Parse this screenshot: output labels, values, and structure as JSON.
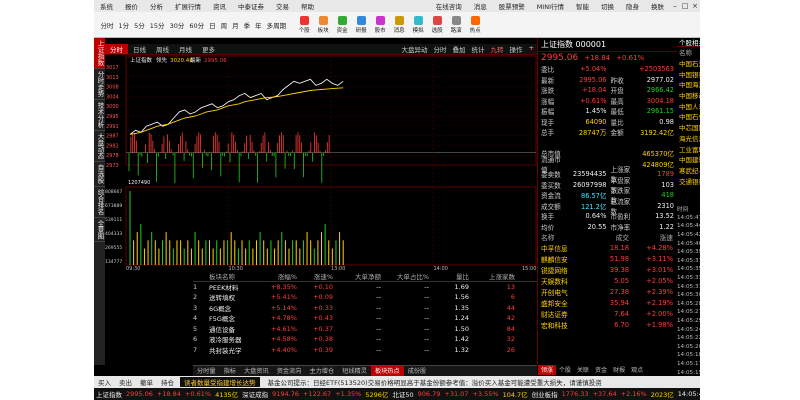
{
  "menubar": {
    "items": [
      "系统",
      "报价",
      "分析",
      "扩展行情",
      "资讯",
      "中泰证券",
      "交易",
      "帮助"
    ],
    "right_items": [
      "在线咨询",
      "消息",
      "股票预警",
      "MINI行情",
      "智能",
      "切换",
      "隐身",
      "换肤"
    ]
  },
  "toolbar": {
    "periods": [
      "分时",
      "1分",
      "5分",
      "15分",
      "30分",
      "60分",
      "日",
      "周",
      "月",
      "季",
      "年",
      "多周期"
    ],
    "buttons": [
      {
        "label": "个股",
        "color": "#e33"
      },
      {
        "label": "板块",
        "color": "#e83"
      },
      {
        "label": "资金",
        "color": "#3a3"
      },
      {
        "label": "研报",
        "color": "#38d"
      },
      {
        "label": "股市",
        "color": "#c3c"
      },
      {
        "label": "消息",
        "color": "#c90"
      },
      {
        "label": "模拟",
        "color": "#3bc"
      },
      {
        "label": "选股",
        "color": "#d44"
      },
      {
        "label": "路演",
        "color": "#888"
      },
      {
        "label": "热点",
        "color": "#f60"
      }
    ]
  },
  "leftbar": [
    "上证指数",
    "分时走势",
    "技术分析",
    "大盘动态",
    "自选股",
    "综合排名",
    "全景图"
  ],
  "chart_tabs": {
    "tabs": [
      "分时",
      "日线",
      "周线",
      "月线",
      "更多"
    ],
    "right": [
      "大盘异动",
      "分时",
      "叠加",
      "统计",
      "九转",
      "操作",
      "+"
    ]
  },
  "chart_header": {
    "name": "上证指数",
    "label2": "领先",
    "v1": "3020.48",
    "label3": "最新",
    "v2": "2995.06"
  },
  "chart_data": {
    "type": "line",
    "y_ticks": [
      "3017",
      "3013",
      "3008",
      "3004",
      "3000",
      "2995",
      "2991",
      "2987",
      "2982",
      "2978",
      "2973"
    ],
    "vol_header": "1207490",
    "vol_ticks": [
      "808667",
      "673889",
      "539111",
      "404333",
      "269555",
      "134777"
    ],
    "x_labels": [
      "09:30",
      "10:30",
      "13:00",
      "14:00",
      "15:00"
    ],
    "ylim": [
      2971,
      3019
    ],
    "series": [
      {
        "values": [
          2986,
          2988,
          2987,
          2990,
          2991,
          2992,
          2990,
          2991,
          2994,
          2997,
          2998,
          2996,
          2997,
          2999,
          3000,
          3001,
          2999,
          3000,
          3002,
          3003,
          3005,
          3006,
          3004,
          3005,
          3006,
          3003,
          3004,
          3005,
          3008,
          3010,
          3012,
          3011,
          3012,
          3013,
          3010,
          3011,
          3013,
          3011,
          3010,
          3012
        ]
      },
      {
        "values": [
          2986,
          2986.5,
          2987,
          2988,
          2989,
          2990,
          2990.5,
          2991,
          2992,
          2993,
          2994,
          2994.5,
          2995,
          2996,
          2997,
          2997.5,
          2998,
          2999,
          3000,
          3000.5,
          3001,
          3002,
          3002.5,
          3003,
          3003.5,
          3004,
          3004.2,
          3004.5,
          3005,
          3005.5,
          3006,
          3006.5,
          3007,
          3007.5,
          3007.8,
          3008,
          3008.2,
          3008.4,
          3008.6,
          3008.8
        ]
      }
    ],
    "volumes": [
      9,
      3,
      4,
      5,
      2,
      3,
      4,
      3,
      2,
      3,
      4,
      3,
      2,
      3,
      3,
      2,
      3,
      2,
      4,
      3,
      2,
      3,
      3,
      2,
      3,
      2,
      3,
      3,
      4,
      3,
      2,
      3,
      2,
      3,
      2,
      3,
      4,
      3,
      2,
      3,
      2,
      3,
      4,
      3,
      2,
      3,
      3,
      2,
      3,
      4,
      3,
      2,
      3,
      4,
      5,
      3,
      2,
      3,
      4,
      3
    ]
  },
  "sector_table": {
    "headers": [
      "板块名称",
      "涨幅%",
      "涨速%",
      "大单净额",
      "大单占比%",
      "量比",
      "上涨家数"
    ],
    "rows": [
      {
        "no": "1",
        "name": "PEEK材料",
        "p1": "+8.35%",
        "p2": "+0.10",
        "big": "--",
        "ratio": "--",
        "vol": "1.69",
        "up": "13"
      },
      {
        "no": "2",
        "name": "送转填权",
        "p1": "+5.41%",
        "p2": "+0.09",
        "big": "--",
        "ratio": "--",
        "vol": "1.56",
        "up": "6"
      },
      {
        "no": "3",
        "name": "6G概念",
        "p1": "+5.14%",
        "p2": "+0.33",
        "big": "--",
        "ratio": "--",
        "vol": "1.35",
        "up": "44"
      },
      {
        "no": "4",
        "name": "F5G概念",
        "p1": "+4.78%",
        "p2": "+0.43",
        "big": "--",
        "ratio": "--",
        "vol": "1.24",
        "up": "42"
      },
      {
        "no": "5",
        "name": "通信设备",
        "p1": "+4.61%",
        "p2": "+0.37",
        "big": "--",
        "ratio": "--",
        "vol": "1.50",
        "up": "84"
      },
      {
        "no": "6",
        "name": "液冷服务器",
        "p1": "+4.58%",
        "p2": "+0.38",
        "big": "--",
        "ratio": "--",
        "vol": "1.42",
        "up": "32"
      },
      {
        "no": "7",
        "name": "共封装光学",
        "p1": "+4.40%",
        "p2": "+0.39",
        "big": "--",
        "ratio": "--",
        "vol": "1.32",
        "up": "26"
      }
    ]
  },
  "bottom_tabs": [
    "分时量",
    "指标",
    "大盘资讯",
    "资金流向",
    "主力增仓",
    "短线精灵",
    "板块热点",
    "成份股"
  ],
  "buttons_bar": {
    "items": [
      "买入",
      "卖出",
      "撤单",
      "持仓"
    ],
    "notice": "读者数量受指建增长达势",
    "notice2": "基金公司提示：日经ETF(513520)交易价格明显高于基金份额参考值：溢价买入基金可能遭受重大损失，请谨慎投资"
  },
  "status": {
    "items": [
      {
        "t": "上证指数",
        "c": "white-t"
      },
      {
        "t": "2995.06",
        "c": "red"
      },
      {
        "t": "+18.84",
        "c": "red"
      },
      {
        "t": "+0.61%",
        "c": "red"
      },
      {
        "t": "4135亿",
        "c": "yellow"
      },
      {
        "t": "深证成指",
        "c": "white-t"
      },
      {
        "t": "9194.76",
        "c": "red"
      },
      {
        "t": "+122.67",
        "c": "red"
      },
      {
        "t": "+1.35%",
        "c": "red"
      },
      {
        "t": "5296亿",
        "c": "yellow"
      },
      {
        "t": "北证50",
        "c": "white-t"
      },
      {
        "t": "906.79",
        "c": "red"
      },
      {
        "t": "+31.07",
        "c": "red"
      },
      {
        "t": "+3.55%",
        "c": "red"
      },
      {
        "t": "104.7亿",
        "c": "yellow"
      },
      {
        "t": "创业板指",
        "c": "white-t"
      },
      {
        "t": "1776.33",
        "c": "red"
      },
      {
        "t": "+37.64",
        "c": "red"
      },
      {
        "t": "+2.16%",
        "c": "red"
      },
      {
        "t": "2023亿",
        "c": "yellow"
      }
    ],
    "time": "14:05:47"
  },
  "quote": {
    "title": "上证指数 000001",
    "price": "2995.06",
    "change": "+18.84",
    "pct": "+0.61%",
    "rows": [
      {
        "k": "委比",
        "v": "+5.04%",
        "vc": "red",
        "k2": "",
        "v2": "+2503563",
        "v2c": "red"
      },
      {
        "k": "最新",
        "v": "2995.06",
        "vc": "red",
        "k2": "昨收",
        "v2": "2977.02",
        "v2c": "white-t"
      },
      {
        "k": "涨跌",
        "v": "+18.04",
        "vc": "red",
        "k2": "开盘",
        "v2": "2966.42",
        "v2c": "green"
      },
      {
        "k": "涨幅",
        "v": "+0.61%",
        "vc": "red",
        "k2": "最高",
        "v2": "3004.18",
        "v2c": "red"
      },
      {
        "k": "振幅",
        "v": "1.45%",
        "vc": "white-t",
        "k2": "最低",
        "v2": "2961.15",
        "v2c": "green"
      },
      {
        "k": "现手",
        "v": "64090",
        "vc": "yellow",
        "k2": "量比",
        "v2": "0.98",
        "v2c": "white-t"
      },
      {
        "k": "总手",
        "v": "28747万",
        "vc": "yellow",
        "k2": "金额",
        "v2": "3192.42亿",
        "v2c": "yellow"
      },
      {
        "k": "",
        "v": "",
        "vc": "white-t",
        "k2": "",
        "v2": "",
        "v2c": "white-t"
      },
      {
        "k": "总市值",
        "v": "",
        "vc": "white-t",
        "k2": "",
        "v2": "465370亿",
        "v2c": "yellow"
      },
      {
        "k": "流通市值",
        "v": "",
        "vc": "white-t",
        "k2": "",
        "v2": "424809亿",
        "v2c": "yellow"
      },
      {
        "k": "委卖数",
        "v": "23594435",
        "vc": "white-t",
        "k2": "上涨家数",
        "v2": "1789",
        "v2c": "red"
      },
      {
        "k": "委买数",
        "v": "26097998",
        "vc": "white-t",
        "k2": "平盘家数",
        "v2": "103",
        "v2c": "white-t"
      },
      {
        "k": "资金流",
        "v": "86.57亿",
        "vc": "cyan",
        "k2": "下跌家数",
        "v2": "418",
        "v2c": "green"
      },
      {
        "k": "成交额",
        "v": "121.2亿",
        "vc": "cyan",
        "k2": "总流家数",
        "v2": "2310",
        "v2c": "white-t"
      },
      {
        "k": "换手",
        "v": "0.64%",
        "vc": "white-t",
        "k2": "市盈利",
        "v2": "13.52",
        "v2c": "white-t"
      },
      {
        "k": "均价",
        "v": "20.55",
        "vc": "white-t",
        "k2": "市净率",
        "v2": "1.22",
        "v2c": "white-t"
      }
    ],
    "tick_header": [
      "名称",
      "成交",
      "涨速"
    ],
    "ticks": [
      {
        "n": "中孚信息",
        "p": "18.18",
        "c": "+4.28%"
      },
      {
        "n": "麒麟信安",
        "p": "51.98",
        "c": "+3.11%"
      },
      {
        "n": "锐捷网络",
        "p": "39.38",
        "c": "+3.01%"
      },
      {
        "n": "天娱数科",
        "p": "5.05",
        "c": "+2.05%"
      },
      {
        "n": "开创电气",
        "p": "27.38",
        "c": "+2.39%"
      },
      {
        "n": "盛邦安全",
        "p": "35.94",
        "c": "+2.19%"
      },
      {
        "n": "财达证券",
        "p": "7.64",
        "c": "+2.00%"
      },
      {
        "n": "宏和科技",
        "p": "6.70",
        "c": "+1.98%"
      }
    ],
    "bottom_tabs": [
      "领涨",
      "个股",
      "关联",
      "资金",
      "财报",
      "观点"
    ]
  },
  "right_panel": {
    "header": "个股相关度",
    "cols": [
      "名称",
      "涨幅%",
      "现价",
      "贡献点"
    ],
    "rows": [
      {
        "n": "中国石油",
        "c": "+0.00",
        "p": "8.84",
        "f": "0.00",
        "pc": "white-t",
        "fc": "white-t"
      },
      {
        "n": "中国银行",
        "c": "+0.17",
        "p": "5.98",
        "f": "0.14",
        "pc": "red",
        "fc": "red"
      },
      {
        "n": "中国海油",
        "c": "+2.15",
        "p": "29.73",
        "f": "0.28",
        "pc": "red",
        "fc": "red"
      },
      {
        "n": "中国移动",
        "c": "+0.16",
        "p": "103.80",
        "f": "0.19",
        "pc": "red",
        "fc": "red"
      },
      {
        "n": "中国人寿",
        "c": "+0.56",
        "p": "38.25",
        "f": "0.06",
        "pc": "red",
        "fc": "red"
      },
      {
        "n": "中国石化",
        "c": "-0.16",
        "p": "6.22",
        "f": "-0.00",
        "pc": "green",
        "fc": "green"
      },
      {
        "n": "中芯国际",
        "c": "+4.65",
        "p": "47.01",
        "f": "0.29",
        "pc": "red",
        "fc": "red"
      },
      {
        "n": "海光信息",
        "c": "+7.36",
        "p": "80.28",
        "f": "0.39",
        "pc": "red",
        "fc": "red"
      },
      {
        "n": "工业富联",
        "c": "+3.46",
        "p": "23.01",
        "f": "0.25",
        "pc": "red",
        "fc": "red"
      },
      {
        "n": "中国建筑",
        "c": "-0.19",
        "p": "5.30",
        "f": "-0.01",
        "pc": "green",
        "fc": "green"
      },
      {
        "n": "寒武纪-U",
        "c": "+5.16",
        "p": "342.55",
        "f": "0.27",
        "pc": "red",
        "fc": "red"
      },
      {
        "n": "交通银行",
        "c": "+0.59",
        "p": "6.81",
        "f": "0.07",
        "pc": "red",
        "fc": "red"
      }
    ],
    "news_header": [
      "时间",
      "名称",
      "类型",
      "全部市场"
    ],
    "news": [
      {
        "t": "14:05:47",
        "a": "中孚信息",
        "b": "急速拉升",
        "d": "4.28%"
      },
      {
        "t": "14:05:44",
        "a": "盛邦安全",
        "b": "急速拉升",
        "d": "2.34%"
      },
      {
        "t": "14:05:42",
        "a": "天娱数科",
        "b": "急速拉升",
        "d": "2.02%"
      },
      {
        "t": "14:05:40",
        "a": "天风证券",
        "b": "大笔买入",
        "d": "21691"
      },
      {
        "t": "14:05:39",
        "a": "国新健康",
        "b": "大笔买入",
        "d": "18372"
      },
      {
        "t": "14:05:37",
        "a": "瑞芯微",
        "b": "大笔买入",
        "d": "13058"
      },
      {
        "t": "14:05:35",
        "a": "宏和科技",
        "b": "急速拉升",
        "d": "2.01%"
      },
      {
        "t": "14:05:33",
        "a": "中国卫通",
        "b": "大笔买入",
        "d": "22156"
      },
      {
        "t": "14:05:31",
        "a": "沃尔核材",
        "b": "封涨停板",
        "d": "10.00%"
      },
      {
        "t": "14:05:30",
        "a": "三六零",
        "b": "大笔买入",
        "d": "38810"
      },
      {
        "t": "14:05:28",
        "a": "光迅科技",
        "b": "大笔买入",
        "d": "17032"
      },
      {
        "t": "14:05:27",
        "a": "中国长城",
        "b": "大笔买入",
        "d": "25814"
      },
      {
        "t": "14:05:25",
        "a": "深桑达A",
        "b": "大笔买入",
        "d": "10443"
      },
      {
        "t": "14:05:24",
        "a": "国盛金控",
        "b": "大笔买入",
        "d": "15629"
      },
      {
        "t": "14:05:22",
        "a": "湘邮科技",
        "b": "急速拉升",
        "d": "3.28%"
      },
      {
        "t": "14:05:20",
        "a": "润和软件",
        "b": "大笔买入",
        "d": "31820"
      },
      {
        "t": "14:05:18",
        "a": "拓维信息",
        "b": "大笔买入",
        "d": "24118"
      },
      {
        "t": "14:05:17",
        "a": "东方财富",
        "b": "大笔买入",
        "d": "52176"
      },
      {
        "t": "14:05:15",
        "a": "中兴通讯",
        "b": "大笔买入",
        "d": "44902"
      },
      {
        "t": "14:05:13",
        "a": "金山办公",
        "b": "大笔买入",
        "d": "12873"
      },
      {
        "t": "14:05:11",
        "a": "同花顺",
        "b": "急速拉升",
        "d": "2.15%"
      },
      {
        "t": "14:05:10",
        "a": "华工科技",
        "b": "大笔买入",
        "d": "18325"
      }
    ]
  },
  "colors": {
    "up": "#ff3c3c",
    "down": "#1fd01f",
    "accent": "#b00000",
    "bg": "#000000"
  }
}
